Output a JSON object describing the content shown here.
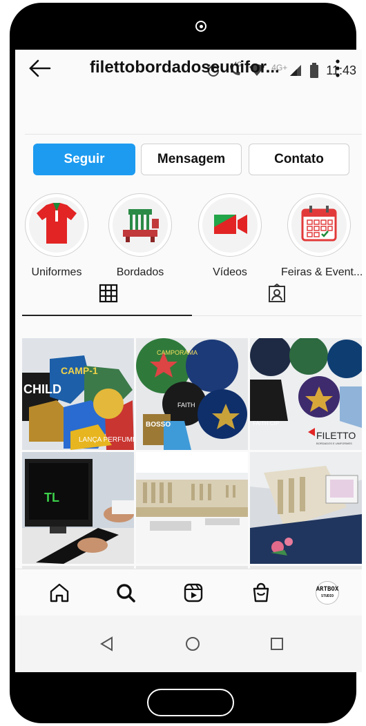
{
  "status_bar": {
    "time": "11:43",
    "network_label": "4G+",
    "call_badge": "4G",
    "icons": [
      "alarm-icon",
      "wifi-call-icon",
      "wifi-icon",
      "signal-icon",
      "battery-icon"
    ]
  },
  "header": {
    "username": "filettobordadoseunifor...",
    "back_icon": "arrow-left-icon",
    "more_icon": "vertical-dots-icon"
  },
  "actions": {
    "follow": "Seguir",
    "message": "Mensagem",
    "contact": "Contato"
  },
  "highlights": [
    {
      "label": "Uniformes",
      "icon": "polo-shirt-icon"
    },
    {
      "label": "Bordados",
      "icon": "embroidery-machine-icon"
    },
    {
      "label": "Vídeos",
      "icon": "video-camera-icon"
    },
    {
      "label": "Feiras & Event...",
      "icon": "calendar-icon"
    }
  ],
  "tabs": [
    {
      "name": "grid",
      "icon": "grid-icon",
      "active": true
    },
    {
      "name": "tagged",
      "icon": "tagged-person-icon",
      "active": false
    }
  ],
  "posts": [
    {
      "subject": "patches"
    },
    {
      "subject": "patches"
    },
    {
      "subject": "patches"
    },
    {
      "subject": "computer"
    },
    {
      "subject": "embroidery-machines"
    },
    {
      "subject": "embroidery-machine-closeup"
    }
  ],
  "post_overlays": {
    "patch1_text": "CHILD",
    "patch2_text": "CAMP-1",
    "patch3_text": "LANÇA PERFUME",
    "patch4_text": "CAMPORAMA",
    "patch5_text": "FAITH",
    "patch6_text": "BOSSO",
    "patch7_text": "FAITH CIP",
    "brand_text": "FILETTO",
    "brand_sub": "BORDADOS E UNIFORMES",
    "screen_text": "TL"
  },
  "bottom_nav": {
    "items": [
      "home-icon",
      "search-icon",
      "reels-icon",
      "shop-icon",
      "profile-avatar"
    ],
    "avatar_text_1": "ARTBOX",
    "avatar_text_2": "STUDIO"
  },
  "system_nav": [
    "back-triangle-icon",
    "home-circle-icon",
    "recents-square-icon"
  ],
  "colors": {
    "follow_button": "#1d9bf0",
    "background": "#fafafa",
    "phone_frame": "#000000"
  }
}
